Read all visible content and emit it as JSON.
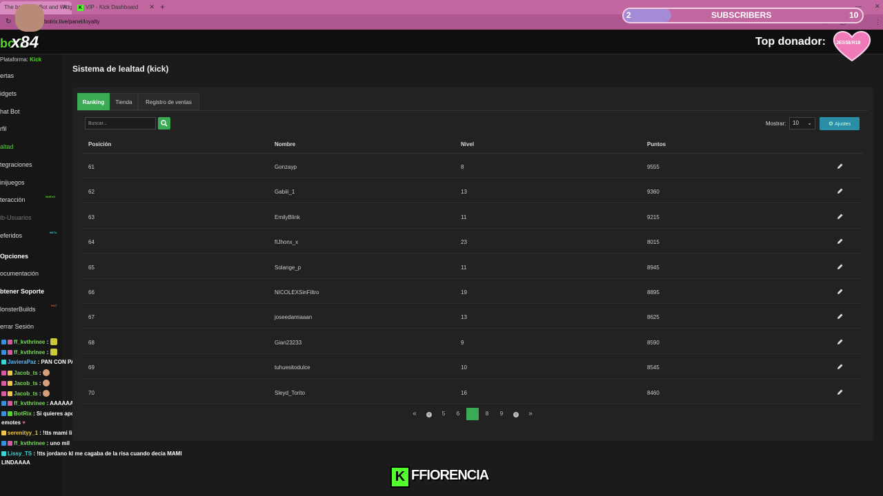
{
  "browser": {
    "tabs": [
      {
        "label": "The best chat Bot and Widgets"
      },
      {
        "label": "VIP - Kick Dashboard"
      }
    ],
    "new_tab": "+",
    "url": "botrix.live/panel/loyalty"
  },
  "app": {
    "logo": "botR",
    "platform_label": "Plataforma:",
    "platform_value": "Kick"
  },
  "sidebar": {
    "items": [
      {
        "label": "ertas"
      },
      {
        "label": "idgets"
      },
      {
        "label": "hat Bot"
      },
      {
        "label": "rfil"
      },
      {
        "label": "altad"
      },
      {
        "label": "tegraciones"
      },
      {
        "label": "inijuegos"
      },
      {
        "label": "teracción",
        "badge": "NUEVO"
      },
      {
        "label": "ib-Usuarios"
      },
      {
        "label": "eferidos",
        "badge": "BETA"
      },
      {
        "label": "Opciones"
      },
      {
        "label": "ocumentación"
      },
      {
        "label": "btener Soporte"
      },
      {
        "label": "lonsterBuilds",
        "badge": "HOT"
      },
      {
        "label": "errar Sesión"
      }
    ]
  },
  "page": {
    "title": "Sistema de lealtad (kick)",
    "tabs": [
      {
        "label": "Ranking"
      },
      {
        "label": "Tienda"
      },
      {
        "label": "Registro de ventas"
      }
    ],
    "search_placeholder": "Buscar...",
    "show_label": "Mostrar:",
    "show_value": "10",
    "settings_label": "Ajustes",
    "columns": [
      "Posición",
      "Nombre",
      "Nivel",
      "Puntos"
    ],
    "rows": [
      {
        "pos": "61",
        "name": "Gonzayp",
        "level": "8",
        "points": "9555"
      },
      {
        "pos": "62",
        "name": "Gabiii_1",
        "level": "13",
        "points": "9360"
      },
      {
        "pos": "63",
        "name": "EmilyBlink",
        "level": "11",
        "points": "9215"
      },
      {
        "pos": "64",
        "name": "fIJhonx_x",
        "level": "23",
        "points": "8015"
      },
      {
        "pos": "65",
        "name": "Solange_p",
        "level": "11",
        "points": "8945"
      },
      {
        "pos": "66",
        "name": "NICOLEXSinFiltro",
        "level": "19",
        "points": "8895"
      },
      {
        "pos": "67",
        "name": "joseedamiaaan",
        "level": "13",
        "points": "8625"
      },
      {
        "pos": "68",
        "name": "Gian23233",
        "level": "9",
        "points": "8590"
      },
      {
        "pos": "69",
        "name": "tuhuesitodulce",
        "level": "10",
        "points": "8545"
      },
      {
        "pos": "70",
        "name": "Sleyd_Torito",
        "level": "16",
        "points": "8460"
      }
    ],
    "pagination": {
      "first": "«",
      "prev": "‹",
      "pages": [
        "5",
        "6",
        "7",
        "8",
        "9"
      ],
      "current": "7",
      "next": "›",
      "last": "»"
    }
  },
  "overlay": {
    "sub_start": "2",
    "sub_title": "SUBSCRIBERS",
    "sub_goal": "10",
    "sub_progress": 0.2,
    "top_donor_label": "Top donador:",
    "top_donor_name": "JESSER18",
    "cam_label": "x84",
    "footer_brand": "FFIORENCIA",
    "footer_k": "K"
  },
  "chat": [
    {
      "user": "ff_kvthrinee",
      "msg": ":",
      "color": "green"
    },
    {
      "user": "ff_kvthrinee",
      "msg": ":",
      "color": "green"
    },
    {
      "user": "JavieraPaz",
      "msg": ": PAN CON PATÉ UNO MIIIIIL",
      "color": "blue"
    },
    {
      "user": "Jacob_ts",
      "msg": ":",
      "color": "green"
    },
    {
      "user": "Jacob_ts",
      "msg": ":",
      "color": "green"
    },
    {
      "user": "Jacob_ts",
      "msg": ":",
      "color": "green"
    },
    {
      "user": "ff_kvthrinee",
      "msg": ": AAAAAAAAAAAY",
      "color": "green"
    },
    {
      "user": "BotRix",
      "msg": ": Si quieres apoyar el directo recuerda comentar y hacer spai",
      "color": "green"
    },
    {
      "user": "",
      "msg": "emotes",
      "color": "green"
    },
    {
      "user": "serenityy_1",
      "msg": ": !tts mami lindaaaaaa",
      "color": "yellow"
    },
    {
      "user": "ff_kvthrinee",
      "msg": ": uno mil",
      "color": "green"
    },
    {
      "user": "Lissy_TS",
      "msg": ": !tts jordano kl me cagaba de la risa cuando decia MAMI",
      "color": "cyan"
    },
    {
      "user": "",
      "msg": "LINDAAAA",
      "color": "cyan"
    }
  ],
  "colors": {
    "accent_green": "#3aaa55",
    "kick_green": "#52ff2d",
    "teal_button": "#2a8fa6",
    "tab_pink": "#c2669f"
  }
}
